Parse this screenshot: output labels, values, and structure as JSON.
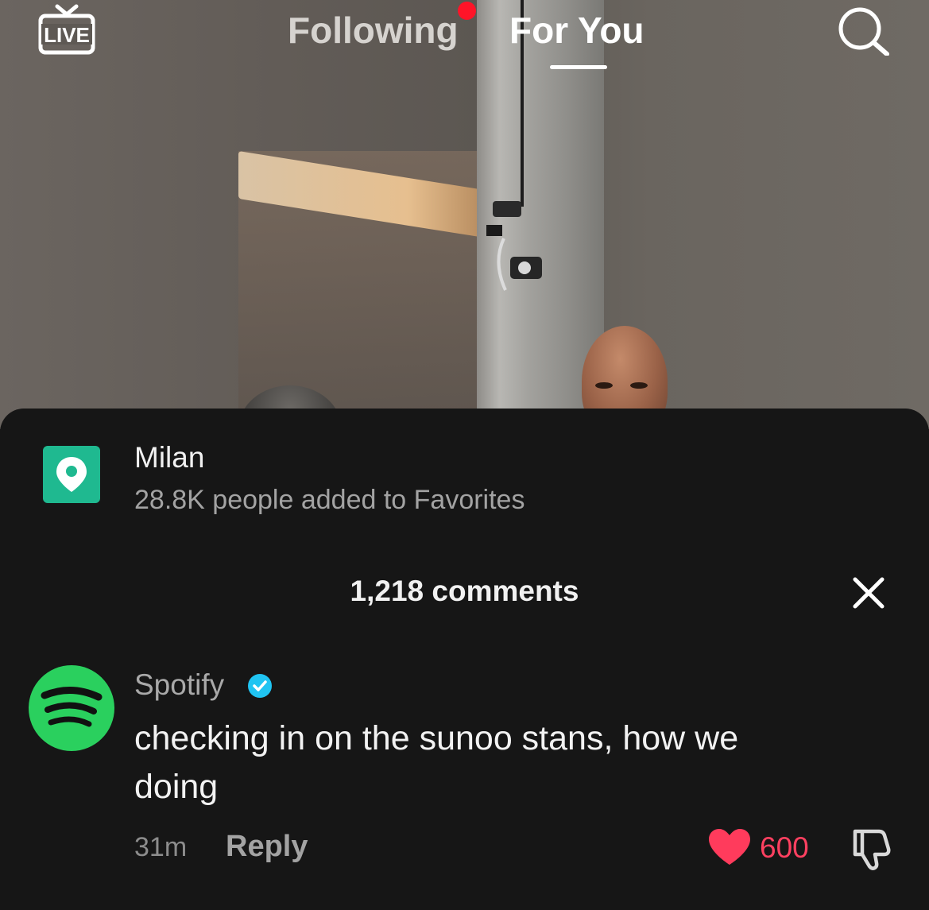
{
  "topnav": {
    "live_label": "LIVE",
    "tabs": [
      {
        "label": "Following",
        "has_notification": true
      },
      {
        "label": "For You",
        "active": true
      }
    ],
    "search_icon": "search-icon"
  },
  "location": {
    "name": "Milan",
    "subtitle": "28.8K people added to Favorites",
    "icon": "location-pin-icon",
    "icon_bg": "#1fb990"
  },
  "comments": {
    "title": "1,218 comments",
    "close_icon": "close-icon",
    "items": [
      {
        "username": "Spotify",
        "verified": true,
        "avatar_icon": "spotify-logo-icon",
        "avatar_color": "#2ad05e",
        "text": "checking in on the sunoo stans, how we doing",
        "time": "31m",
        "reply_label": "Reply",
        "likes": "600",
        "liked": true,
        "like_color": "#ff4060"
      }
    ]
  }
}
